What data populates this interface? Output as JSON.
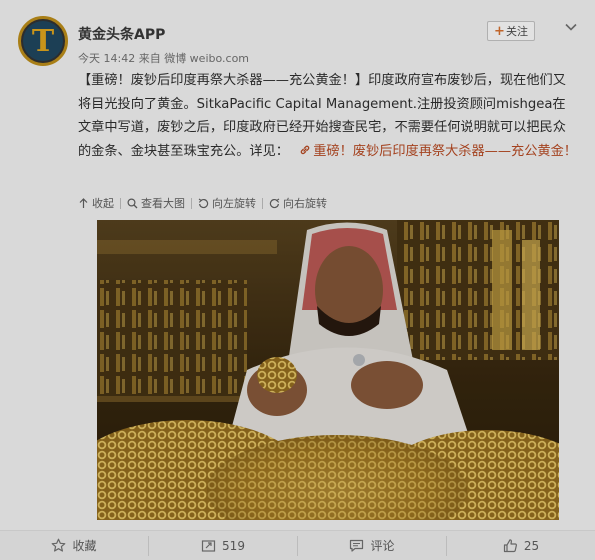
{
  "post": {
    "username": "黄金头条APP",
    "avatar_letter": "T",
    "meta": "今天 14:42 来自 微博 weibo.com",
    "follow_label": "关注",
    "text_main": "【重磅！废钞后印度再祭大杀器——充公黄金！】印度政府宣布废钞后，现在他们又将目光投向了黄金。SitkaPacific Capital Management.注册投资顾问mishgea在文章中写道，废钞之后，印度政府已经开始搜查民宅，不需要任何说明就可以把民众的金条、金块甚至珠宝充公。详见：",
    "link_text": "重磅！废钞后印度再祭大杀器——充公黄金！"
  },
  "tools": {
    "collapse": "收起",
    "view_large": "查看大图",
    "rotate_left": "向左旋转",
    "rotate_right": "向右旋转"
  },
  "actions": {
    "favorite": "收藏",
    "repost_count": "519",
    "comment": "评论",
    "like_count": "25"
  },
  "colors": {
    "link": "#a4421f",
    "avatar_gold": "#c8941a",
    "avatar_bg": "#1c3f55"
  },
  "icons": [
    "chevron-down-icon",
    "collapse-up-icon",
    "search-icon",
    "rotate-left-icon",
    "rotate-right-icon",
    "link-icon",
    "star-icon",
    "repost-icon",
    "comment-icon",
    "thumbs-up-icon"
  ]
}
